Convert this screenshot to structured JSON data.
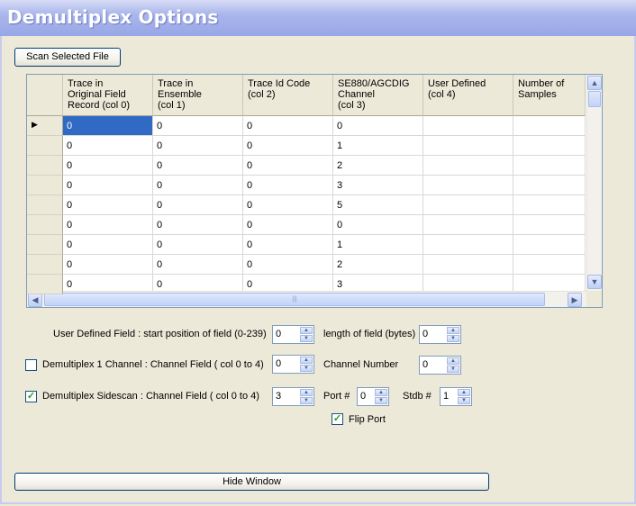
{
  "window": {
    "title": "Demultiplex Options"
  },
  "scan_button": "Scan Selected File",
  "grid": {
    "columns": [
      "Trace in\nOriginal Field\nRecord (col 0)",
      "Trace in\nEnsemble\n(col 1)",
      "Trace Id Code\n(col 2)",
      "SE880/AGCDIG\nChannel\n(col 3)",
      "User Defined\n(col 4)",
      "Number of\nSamples"
    ],
    "rows": [
      [
        "0",
        "0",
        "0",
        "0",
        "",
        ""
      ],
      [
        "0",
        "0",
        "0",
        "1",
        "",
        ""
      ],
      [
        "0",
        "0",
        "0",
        "2",
        "",
        ""
      ],
      [
        "0",
        "0",
        "0",
        "3",
        "",
        ""
      ],
      [
        "0",
        "0",
        "0",
        "5",
        "",
        ""
      ],
      [
        "0",
        "0",
        "0",
        "0",
        "",
        ""
      ],
      [
        "0",
        "0",
        "0",
        "1",
        "",
        ""
      ],
      [
        "0",
        "0",
        "0",
        "2",
        "",
        ""
      ],
      [
        "0",
        "0",
        "0",
        "3",
        "",
        ""
      ]
    ],
    "current_row_marker": "▶"
  },
  "user_defined": {
    "label": "User Defined Field : start position of field (0-239)",
    "start_value": "0",
    "length_label": "length of field (bytes)",
    "length_value": "0"
  },
  "demux1": {
    "checked": false,
    "label": "Demultiplex 1  Channel : Channel Field ( col 0 to 4)",
    "field_value": "0",
    "channel_label": "Channel Number",
    "channel_value": "0"
  },
  "sidescan": {
    "checked": true,
    "label": "Demultiplex Sidescan :   Channel Field ( col 0 to 4)",
    "field_value": "3",
    "port_label": "Port #",
    "port_value": "0",
    "stdb_label": "Stdb #",
    "stdb_value": "1",
    "flip_checked": true,
    "flip_label": "Flip Port"
  },
  "hide_button": "Hide Window",
  "check_glyph": "✓",
  "icons": {
    "up": "▲",
    "down": "▼",
    "left": "◀",
    "right": "▶",
    "grip": "|||"
  }
}
